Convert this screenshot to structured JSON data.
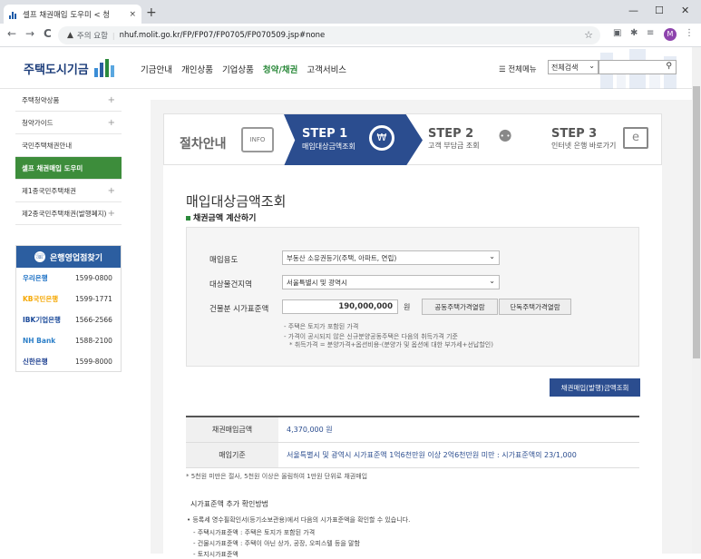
{
  "browser": {
    "tab_title": "셀프 채권매입 도우미 < 청",
    "tab_close": "×",
    "new_tab": "+",
    "insecure_label": "주의 요함",
    "url": "nhuf.molit.go.kr/FP/FP07/FP0705/FP070509.jsp#none",
    "profile_initial": "M",
    "minimize": "—",
    "maximize": "☐",
    "close": "✕",
    "back": "←",
    "forward": "→",
    "reload": "C"
  },
  "header": {
    "logo_text": "주택도시기금",
    "nav": [
      "기금안내",
      "개인상품",
      "기업상품",
      "청약/채권",
      "고객서비스"
    ],
    "active_nav": "청약/채권",
    "all_menu": "☰ 전체메뉴",
    "search_select": "전체검색",
    "search_placeholder": ""
  },
  "sidebar": {
    "items": [
      {
        "label": "주택청약상품",
        "plus": "+"
      },
      {
        "label": "청약가이드",
        "plus": "+"
      },
      {
        "label": "국민주택채권안내",
        "plus": ""
      },
      {
        "label": "셀프 채권매입 도우미",
        "plus": ""
      },
      {
        "label": "제1종국민주택채권",
        "plus": "+"
      },
      {
        "label": "제2종국민주택채권(발행폐지)",
        "plus": "+"
      }
    ],
    "bank_title": "은행영업점찾기",
    "banks": [
      {
        "name": "우리은행",
        "tel": "1599-0800",
        "color": "#1a6fc4"
      },
      {
        "name": "KB국민은행",
        "tel": "1599-1771",
        "color": "#f5a700"
      },
      {
        "name": "IBK기업은행",
        "tel": "1566-2566",
        "color": "#1b4a9a"
      },
      {
        "name": "NH Bank",
        "tel": "1588-2100",
        "color": "#2c7fc8"
      },
      {
        "name": "신한은행",
        "tel": "1599-8000",
        "color": "#1a3d8f"
      }
    ]
  },
  "steps": {
    "guide": "절차안내",
    "guide_icon_label": "INFO",
    "step1_num": "STEP 1",
    "step1_label": "매입대상금액조회",
    "step2_num": "STEP 2",
    "step2_label": "고객 부담금 조회",
    "step3_num": "STEP 3",
    "step3_label": "인터넷 은행 바로가기"
  },
  "main": {
    "title": "매입대상금액조회",
    "subtitle": "채권금액 계산하기",
    "purpose_label": "매입용도",
    "purpose_value": "부동산 소유권등기(주택, 아파트, 연립)",
    "region_label": "대상물건지역",
    "region_value": "서울특별시 및 광역시",
    "price_label": "건물분 시가표준액",
    "price_value": "190,000,000",
    "won": "원",
    "btn_public": "공동주택가격열람",
    "btn_single": "단독주택가격열람",
    "note1": "- 주택은 토지가 포함된 가격",
    "note2": "- 가격이 공시되지 않은 신규분양공동주택은 다음의 취득가격 기준",
    "note3": "* 취득가격 = 분양가격+옵션비용-(분양가 및 옵션에 대한 부가세+선납할인)",
    "calc_button": "채권매입(발행)금액조회",
    "result_amount_label": "채권매입금액",
    "result_amount": "4,370,000 원",
    "result_basis_label": "매입기준",
    "result_basis": "서울특별시 및 광역시 시가표준액 1억6천만원 이상 2억6천만원 미만 : 시가표준액의 23/1,000",
    "footnote": "* 5천원 미만은 절사, 5천원 이상은 올림하여 1만원 단위로 채권매입",
    "how_title": "시가표준액 추가 확인방법",
    "how1": "• 등록세 영수필확인서(등기소보관용)에서 다음의 시가표준액을 확인할 수 있습니다.",
    "how2": "- 주택시가표준액 : 주택은 토지가 포함된 가격",
    "how3": "- 건물시가표준액 : 주택이 아닌 상가, 공장, 오피스텔 등을 말함",
    "how4": "- 토지시가표준액"
  }
}
